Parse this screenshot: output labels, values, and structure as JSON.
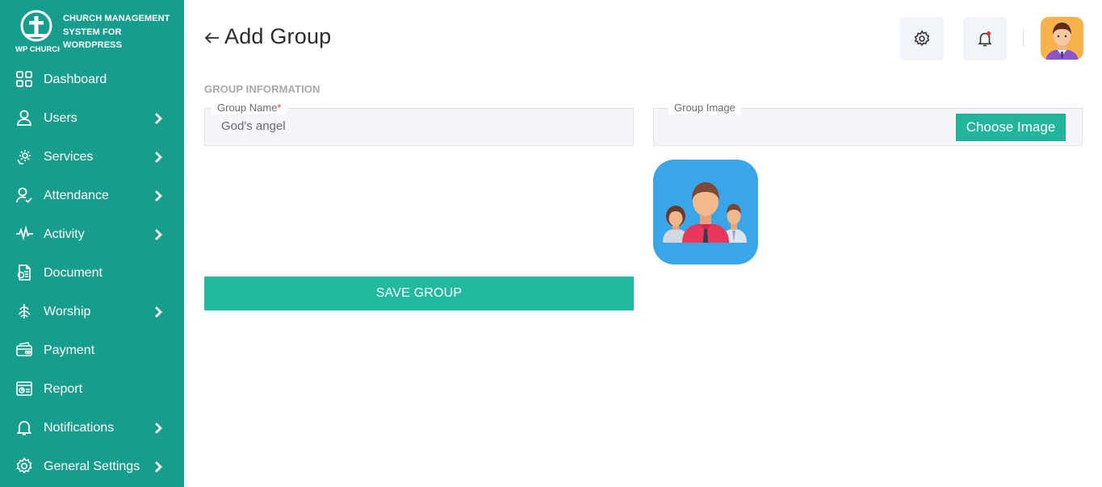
{
  "brand": {
    "logo_text": "WP CHURCH",
    "title_line1": "CHURCH MANAGEMENT",
    "title_line2": "SYSTEM FOR",
    "title_line3": "WORDPRESS"
  },
  "sidebar": {
    "items": [
      {
        "label": "Dashboard",
        "icon": "dashboard-grid-icon",
        "has_submenu": false
      },
      {
        "label": "Users",
        "icon": "user-icon",
        "has_submenu": true
      },
      {
        "label": "Services",
        "icon": "services-gear-icon",
        "has_submenu": true
      },
      {
        "label": "Attendance",
        "icon": "attendance-user-check-icon",
        "has_submenu": true
      },
      {
        "label": "Activity",
        "icon": "activity-pulse-icon",
        "has_submenu": true
      },
      {
        "label": "Document",
        "icon": "document-icon",
        "has_submenu": false
      },
      {
        "label": "Worship",
        "icon": "worship-icon",
        "has_submenu": true
      },
      {
        "label": "Payment",
        "icon": "payment-icon",
        "has_submenu": false
      },
      {
        "label": "Report",
        "icon": "report-icon",
        "has_submenu": false
      },
      {
        "label": "Notifications",
        "icon": "bell-icon",
        "has_submenu": true
      },
      {
        "label": "General Settings",
        "icon": "settings-gear-icon",
        "has_submenu": true
      }
    ]
  },
  "header": {
    "title": "Add Group"
  },
  "form": {
    "section_title": "GROUP INFORMATION",
    "group_name": {
      "label": "Group Name",
      "required_mark": "*",
      "value": "God's angel"
    },
    "group_image": {
      "label": "Group Image",
      "button_label": "Choose Image"
    },
    "save_label": "SAVE GROUP"
  },
  "colors": {
    "sidebar_bg": "#179d8e",
    "accent": "#22b9a0",
    "notification_dot": "#e53935",
    "avatar_bg": "#f7b34b",
    "group_image_bg": "#3aa6e8"
  }
}
